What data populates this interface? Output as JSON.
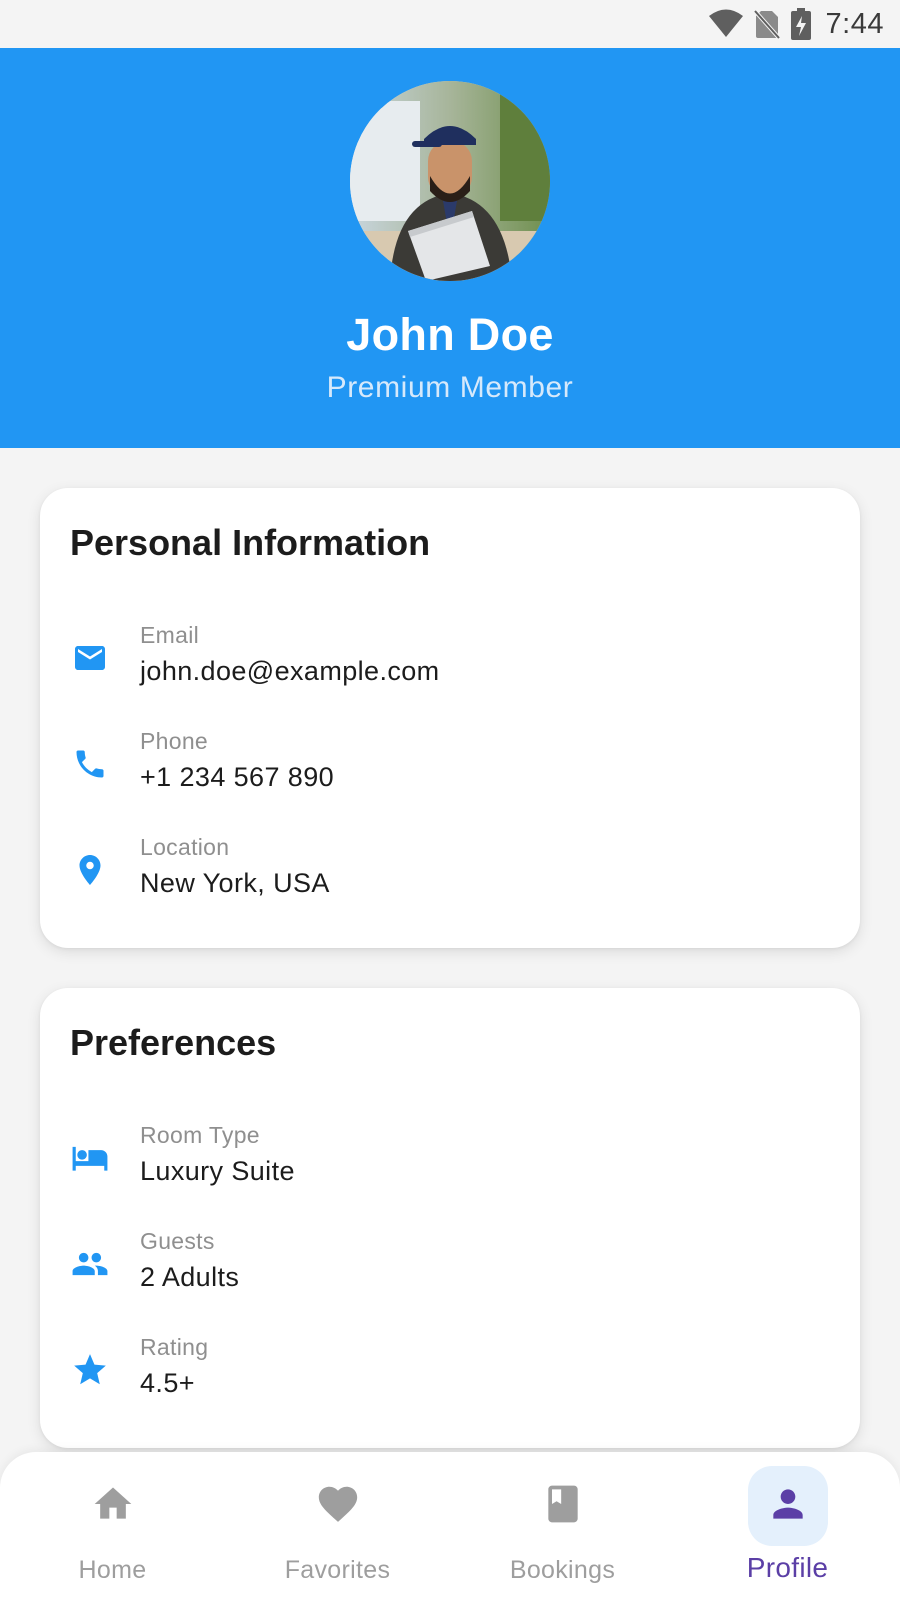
{
  "status_bar": {
    "time": "7:44",
    "icons": [
      "wifi-icon",
      "no-sim-icon",
      "battery-charging-icon"
    ]
  },
  "profile": {
    "name": "John Doe",
    "membership": "Premium Member"
  },
  "personal_info": {
    "title": "Personal Information",
    "items": [
      {
        "icon": "email-icon",
        "label": "Email",
        "value": "john.doe@example.com"
      },
      {
        "icon": "phone-icon",
        "label": "Phone",
        "value": "+1 234 567 890"
      },
      {
        "icon": "location-pin-icon",
        "label": "Location",
        "value": "New York, USA"
      }
    ]
  },
  "preferences": {
    "title": "Preferences",
    "items": [
      {
        "icon": "bed-icon",
        "label": "Room Type",
        "value": "Luxury Suite"
      },
      {
        "icon": "people-icon",
        "label": "Guests",
        "value": "2 Adults"
      },
      {
        "icon": "star-icon",
        "label": "Rating",
        "value": "4.5+"
      }
    ]
  },
  "bottom_nav": {
    "active": "Profile",
    "items": [
      {
        "icon": "home-icon",
        "label": "Home"
      },
      {
        "icon": "heart-icon",
        "label": "Favorites"
      },
      {
        "icon": "book-icon",
        "label": "Bookings"
      },
      {
        "icon": "person-icon",
        "label": "Profile"
      }
    ]
  },
  "colors": {
    "primary": "#2196f3",
    "active_nav": "#5b3fa6",
    "active_nav_bg": "#e4f0fc",
    "background": "#f4f4f4"
  }
}
